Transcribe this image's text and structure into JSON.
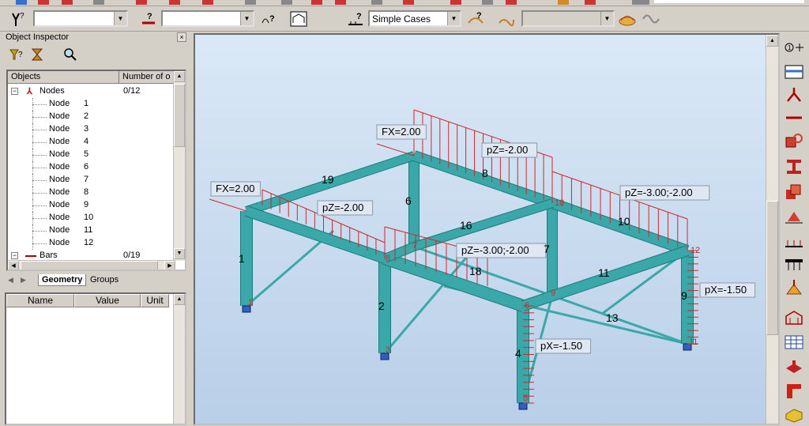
{
  "toolbar": {
    "load_case_combo": "Simple Cases"
  },
  "object_inspector": {
    "title": "Object Inspector",
    "close_glyph": "×",
    "columns": {
      "objects": "Objects",
      "number": "Number of o"
    },
    "nodes_group": {
      "label": "Nodes",
      "count": "0/12"
    },
    "node_prefix": "Node",
    "nodes": [
      "1",
      "2",
      "3",
      "4",
      "5",
      "6",
      "7",
      "8",
      "9",
      "10",
      "11",
      "12"
    ],
    "bars_group": {
      "label": "Bars",
      "count": "0/19"
    },
    "tabs": {
      "geometry": "Geometry",
      "groups": "Groups"
    }
  },
  "properties": {
    "columns": {
      "name": "Name",
      "value": "Value",
      "unit": "Unit"
    }
  },
  "model": {
    "load_labels": {
      "fx_left": "FX=2.00",
      "fx_top": "FX=2.00",
      "pz_top": "pZ=-2.00",
      "pz_left": "pZ=-2.00",
      "pz_right": "pZ=-3.00;-2.00",
      "pz_mid": "pZ=-3.00;-2.00",
      "px_right": "pX=-1.50",
      "px_bottom": "pX=-1.50"
    },
    "bar_numbers": [
      "1",
      "2",
      "4",
      "6",
      "7",
      "8",
      "9",
      "10",
      "11",
      "13",
      "16",
      "18",
      "19"
    ],
    "node_numbers": [
      "1",
      "3",
      "5",
      "6",
      "7",
      "8",
      "9",
      "10",
      "11",
      "12"
    ],
    "colors": {
      "member": "#3aa8a8",
      "member_dark": "#1f7a7a",
      "load": "#cc2a2a",
      "node": "#c03030",
      "background_top": "#d7e6f5",
      "background_bottom": "#bcd2ea"
    }
  }
}
